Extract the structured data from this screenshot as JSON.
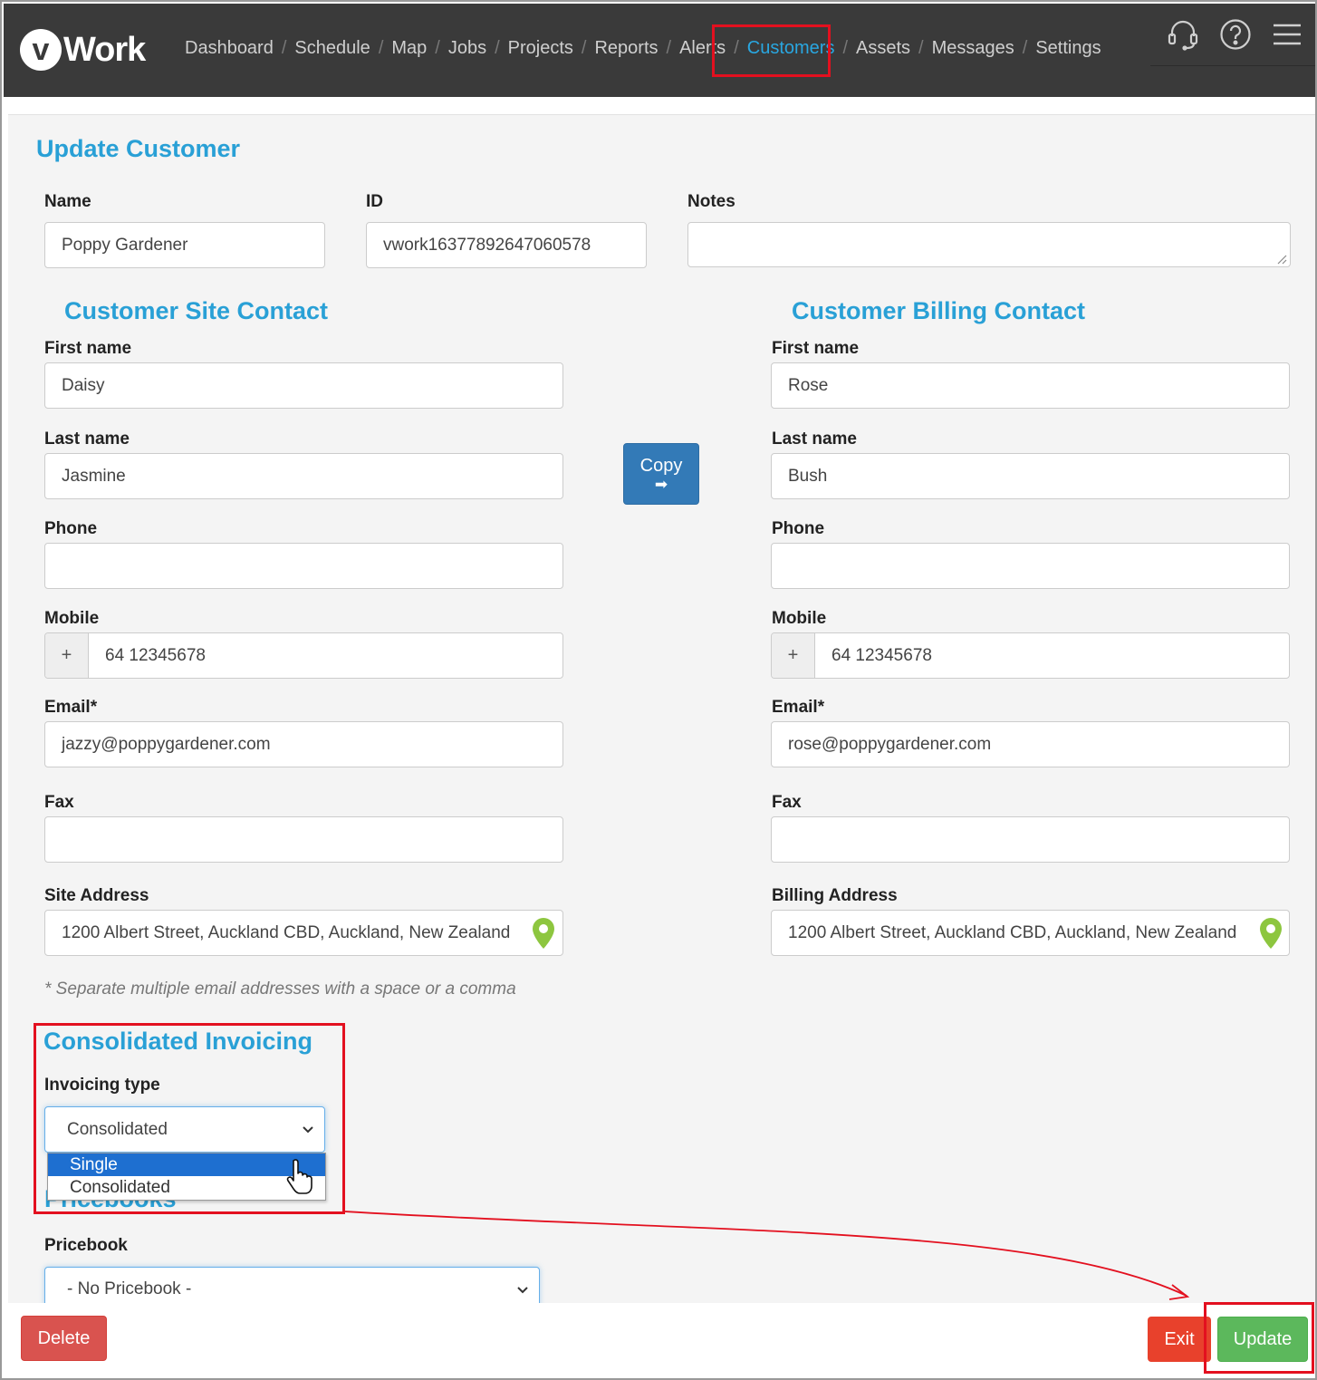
{
  "app": {
    "logo_letter": "v",
    "logo_text": "Work"
  },
  "nav": {
    "items": [
      "Dashboard",
      "Schedule",
      "Map",
      "Jobs",
      "Projects",
      "Reports",
      "Alerts",
      "Customers",
      "Assets",
      "Messages",
      "Settings"
    ],
    "active": "Customers",
    "separator": "/"
  },
  "page": {
    "title": "Update Customer"
  },
  "customer": {
    "name_label": "Name",
    "name_value": "Poppy Gardener",
    "id_label": "ID",
    "id_value": "vwork16377892647060578",
    "notes_label": "Notes",
    "notes_value": ""
  },
  "site_contact": {
    "heading": "Customer Site Contact",
    "first_name_label": "First name",
    "first_name": "Daisy",
    "last_name_label": "Last name",
    "last_name": "Jasmine",
    "phone_label": "Phone",
    "phone": "",
    "mobile_label": "Mobile",
    "mobile_prefix": "+",
    "mobile": "64 12345678",
    "email_label": "Email*",
    "email": "jazzy@poppygardener.com",
    "fax_label": "Fax",
    "fax": "",
    "address_label": "Site Address",
    "address": "1200 Albert Street, Auckland CBD, Auckland, New Zealand"
  },
  "billing_contact": {
    "heading": "Customer Billing Contact",
    "first_name_label": "First name",
    "first_name": "Rose",
    "last_name_label": "Last name",
    "last_name": "Bush",
    "phone_label": "Phone",
    "phone": "",
    "mobile_label": "Mobile",
    "mobile_prefix": "+",
    "mobile": "64 12345678",
    "email_label": "Email*",
    "email": "rose@poppygardener.com",
    "fax_label": "Fax",
    "fax": "",
    "address_label": "Billing Address",
    "address": "1200 Albert Street, Auckland CBD, Auckland, New Zealand"
  },
  "copy_button": {
    "label": "Copy",
    "arrow": "➡"
  },
  "hint": "* Separate multiple email addresses with a space or a comma",
  "invoicing": {
    "heading": "Consolidated Invoicing",
    "type_label": "Invoicing type",
    "selected": "Consolidated",
    "options": [
      "Single",
      "Consolidated"
    ],
    "highlighted_option": "Single"
  },
  "pricebooks": {
    "heading": "Pricebooks",
    "label": "Pricebook",
    "selected": "- No Pricebook -"
  },
  "actions": {
    "delete": "Delete",
    "exit": "Exit",
    "update": "Update"
  },
  "colors": {
    "accent": "#29a0d6",
    "nav_bg": "#3a3a3a",
    "primary_button": "#337ab7",
    "danger": "#d9534f",
    "success": "#5cb85c",
    "annotation": "#e3101f",
    "pin": "#8dc63f"
  }
}
